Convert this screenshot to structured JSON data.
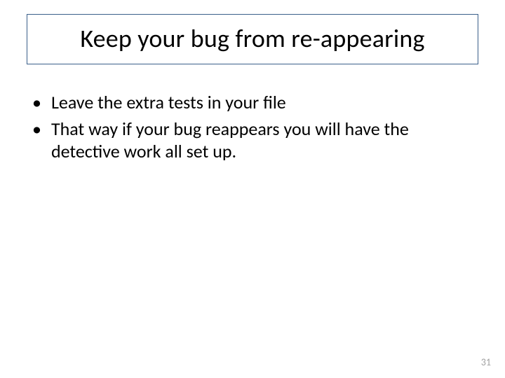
{
  "slide": {
    "title": "Keep your bug from re-appearing",
    "bullets": [
      "Leave the extra tests in your file",
      "That way if your bug reappears you will have the detective work all set up."
    ],
    "page_number": "31"
  }
}
